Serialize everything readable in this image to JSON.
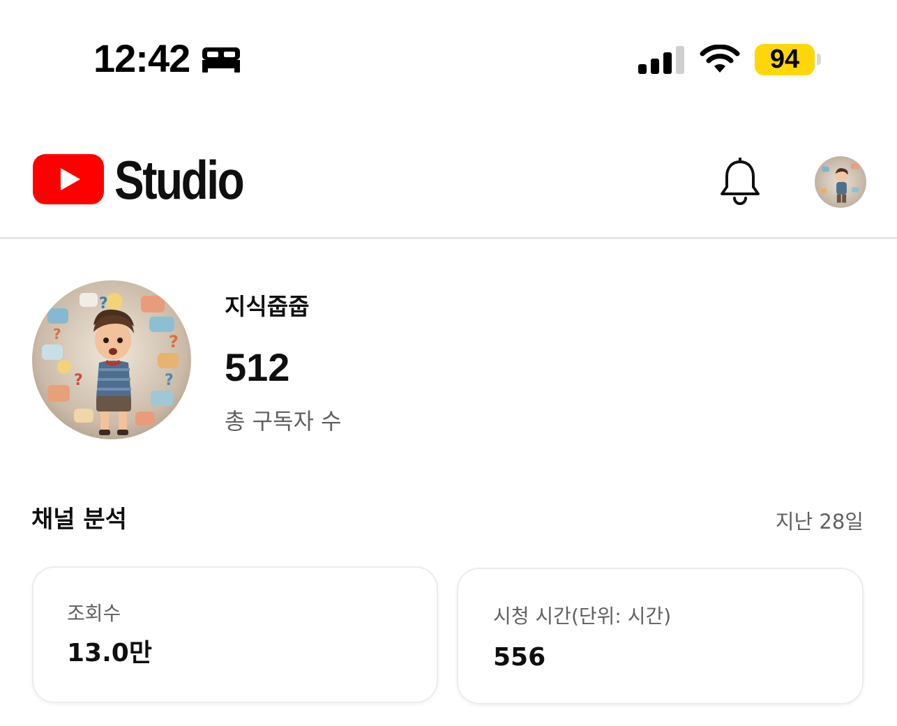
{
  "status_bar": {
    "time": "12:42",
    "battery_level": "94",
    "battery_color": "#ffd60a",
    "icons": [
      "bed-icon",
      "signal-icon",
      "wifi-icon"
    ]
  },
  "header": {
    "logo_icon": "youtube-logo",
    "title": "Studio",
    "brand_color": "#ff0000",
    "actions": [
      "bell-icon",
      "account-avatar"
    ]
  },
  "channel": {
    "name": "지식줍줍",
    "subscriber_count": "512",
    "subscriber_label": "총 구독자 수"
  },
  "analytics": {
    "title": "채널 분석",
    "period": "지난 28일",
    "cards": [
      {
        "label": "조회수",
        "value": "13.0만"
      },
      {
        "label": "시청 시간(단위: 시간)",
        "value": "556"
      }
    ]
  }
}
